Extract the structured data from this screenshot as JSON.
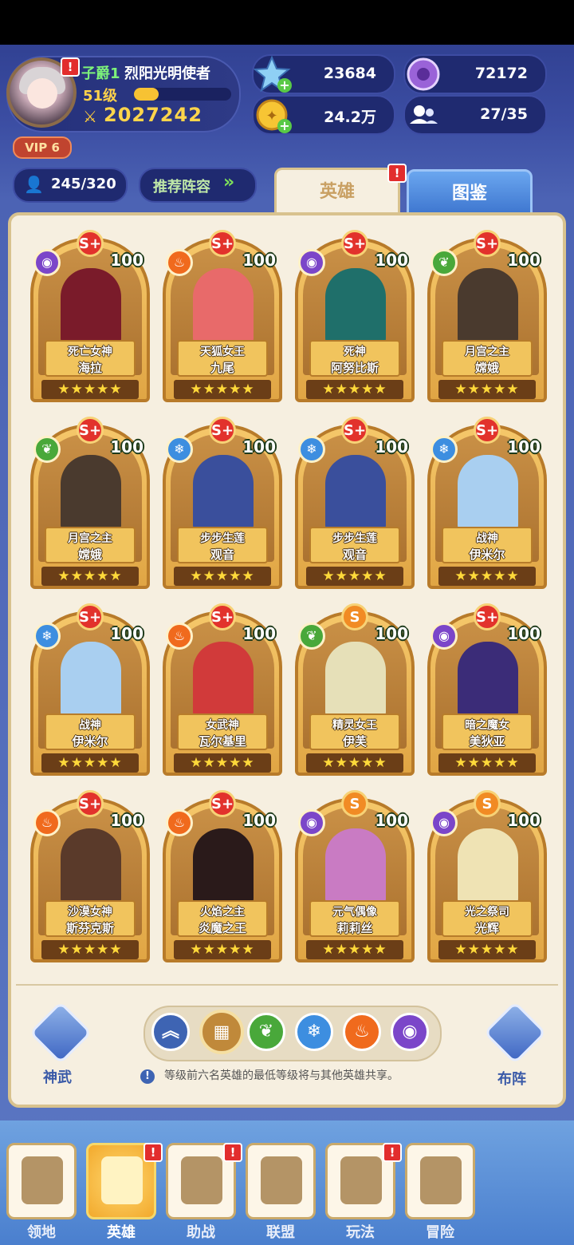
{
  "player": {
    "rank_title": "子爵1",
    "name": "烈阳光明使者",
    "level": "51级",
    "level_progress": 0.25,
    "power": "2027242",
    "vip": "VIP 6"
  },
  "currencies": {
    "crystal": "23684",
    "purple_gem": "72172",
    "gold": "24.2万",
    "members": "27/35"
  },
  "roster_count": "245/320",
  "recommend_label": "推荐阵容",
  "tabs": {
    "heroes": "英雄",
    "codex": "图鉴"
  },
  "heroes": [
    {
      "title": "死亡女神",
      "name": "海拉",
      "element": "dark",
      "rank": "S+",
      "level": "100",
      "stars": "★★★★★",
      "color": "#7a1b2a"
    },
    {
      "title": "天狐女王",
      "name": "九尾",
      "element": "fire",
      "rank": "S+",
      "level": "100",
      "stars": "★★★★★",
      "color": "#e86a6a"
    },
    {
      "title": "死神",
      "name": "阿努比斯",
      "element": "dark",
      "rank": "S+",
      "level": "100",
      "stars": "★★★★★",
      "color": "#1f6f6a"
    },
    {
      "title": "月宫之主",
      "name": "嫦娥",
      "element": "nature",
      "rank": "S+",
      "level": "100",
      "stars": "★★★★★",
      "color": "#4a3a2e"
    },
    {
      "title": "月宫之主",
      "name": "嫦娥",
      "element": "nature",
      "rank": "S+",
      "level": "100",
      "stars": "★★★★★",
      "color": "#4a3a2e"
    },
    {
      "title": "步步生莲",
      "name": "观音",
      "element": "ice",
      "rank": "S+",
      "level": "100",
      "stars": "★★★★★",
      "color": "#3a4f9c"
    },
    {
      "title": "步步生莲",
      "name": "观音",
      "element": "ice",
      "rank": "S+",
      "level": "100",
      "stars": "★★★★★",
      "color": "#3a4f9c"
    },
    {
      "title": "战神",
      "name": "伊米尔",
      "element": "ice",
      "rank": "S+",
      "level": "100",
      "stars": "★★★★★",
      "color": "#a9cff0"
    },
    {
      "title": "战神",
      "name": "伊米尔",
      "element": "ice",
      "rank": "S+",
      "level": "100",
      "stars": "★★★★★",
      "color": "#a9cff0"
    },
    {
      "title": "女武神",
      "name": "瓦尔基里",
      "element": "fire",
      "rank": "S+",
      "level": "100",
      "stars": "★★★★★",
      "color": "#d13a3a"
    },
    {
      "title": "精灵女王",
      "name": "伊芙",
      "element": "nature",
      "rank": "S",
      "level": "100",
      "stars": "★★★★★",
      "color": "#e6e0b8"
    },
    {
      "title": "暗之魔女",
      "name": "美狄亚",
      "element": "dark",
      "rank": "S+",
      "level": "100",
      "stars": "★★★★★",
      "color": "#3b2c78"
    },
    {
      "title": "沙漠女神",
      "name": "斯芬克斯",
      "element": "fire",
      "rank": "S+",
      "level": "100",
      "stars": "★★★★★",
      "color": "#5a3a2a"
    },
    {
      "title": "火焰之主",
      "name": "炎魔之王",
      "element": "fire",
      "rank": "S+",
      "level": "100",
      "stars": "★★★★★",
      "color": "#2a1a1a"
    },
    {
      "title": "元气偶像",
      "name": "莉莉丝",
      "element": "dark",
      "rank": "S",
      "level": "100",
      "stars": "★★★★★",
      "color": "#c97bc3"
    },
    {
      "title": "光之祭司",
      "name": "光辉",
      "element": "dark",
      "rank": "S",
      "level": "100",
      "stars": "★★★★★",
      "color": "#efe3b4"
    }
  ],
  "element_colors": {
    "fire": "#f06a1d",
    "ice": "#3d8ee0",
    "nature": "#49a83a",
    "dark": "#7b46c9"
  },
  "filters": [
    {
      "icon": "double-chevron-up-icon",
      "glyph": "︽",
      "color": "#3e64b3"
    },
    {
      "icon": "grid-icon",
      "glyph": "▦",
      "color": "#c0893a"
    },
    {
      "icon": "nature-icon",
      "glyph": "❦",
      "color": "#49a83a"
    },
    {
      "icon": "ice-icon",
      "glyph": "❄",
      "color": "#3d8ee0"
    },
    {
      "icon": "fire-icon",
      "glyph": "♨",
      "color": "#f06a1d"
    },
    {
      "icon": "dark-icon",
      "glyph": "◉",
      "color": "#7b46c9"
    }
  ],
  "side_buttons": {
    "left": "神武",
    "right": "布阵"
  },
  "info_text": "等级前六名英雄的最低等级将与其他英雄共享。",
  "nav": [
    {
      "label": "领地",
      "alert": false
    },
    {
      "label": "英雄",
      "alert": true,
      "active": true
    },
    {
      "label": "助战",
      "alert": true
    },
    {
      "label": "联盟",
      "alert": false
    },
    {
      "label": "玩法",
      "alert": true
    },
    {
      "label": "冒险",
      "alert": false
    }
  ]
}
